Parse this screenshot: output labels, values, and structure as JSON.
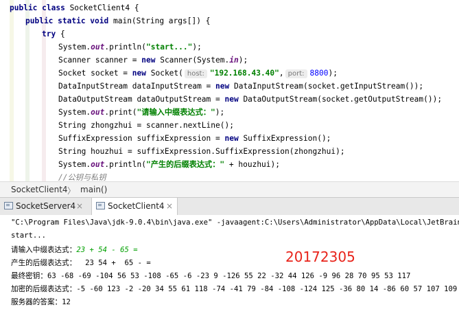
{
  "editor": {
    "line1": {
      "kw": "public class",
      "name": " SocketClient4 {"
    },
    "line2": {
      "kw": "public static void",
      "rest": " main(String args[]) {"
    },
    "line3": {
      "kw": "try",
      "rest": " {"
    },
    "line4": {
      "a": "System.",
      "field": "out",
      "b": ".println(",
      "str": "\"start...\"",
      "c": ");"
    },
    "line5": {
      "a": "Scanner scanner = ",
      "kw": "new",
      "b": " Scanner(System.",
      "field": "in",
      "c": ");"
    },
    "line6": {
      "a": "Socket socket = ",
      "kw": "new",
      "b": " Socket(",
      "hint1": "host:",
      "str": "\"192.168.43.40\"",
      "c": ",",
      "hint2": "port:",
      "num": "8800",
      "d": ");"
    },
    "line7": {
      "a": "DataInputStream dataInputStream = ",
      "kw": "new",
      "b": " DataInputStream(socket.getInputStream());"
    },
    "line8": {
      "a": "DataOutputStream dataOutputStream = ",
      "kw": "new",
      "b": " DataOutputStream(socket.getOutputStream());"
    },
    "line9": {
      "a": "System.",
      "field": "out",
      "b": ".print(",
      "str": "\"请输入中缀表达式：\"",
      "c": ");"
    },
    "line10": {
      "a": "String zhongzhui = scanner.nextLine();"
    },
    "line11": {
      "a": "SuffixExpression suffixExpression = ",
      "kw": "new",
      "b": " SuffixExpression();"
    },
    "line12": {
      "a": "String houzhui = suffixExpression.SuffixExpression(zhongzhui);"
    },
    "line13": {
      "a": "System.",
      "field": "out",
      "b": ".println(",
      "str": "\"产生的后缀表达式：\"",
      "c": " + houzhui);"
    },
    "line14": {
      "comment": "//公钥与私钥"
    }
  },
  "breadcrumb": {
    "class": "SocketClient4",
    "sep": "〉",
    "method": "main()"
  },
  "tabs": [
    {
      "label": "SocketServer4",
      "close": "×"
    },
    {
      "label": "SocketClient4",
      "close": "×"
    }
  ],
  "console": {
    "cmd": "\"C:\\Program Files\\Java\\jdk-9.0.4\\bin\\java.exe\" -javaagent:C:\\Users\\Administrator\\AppData\\Local\\JetBrains\\Tool",
    "start": "start...",
    "infix_label": "请输入中缀表达式：",
    "infix_input": "23 + 54 - 65 =",
    "postfix": "产生的后缀表达式：  23 54 +  65 - =",
    "key": "最终密钥：63 -68 -69 -104 56 53 -108 -65 -6 -23 9 -126 55 22 -32 44 126 -9 96 28 70 95 53 117",
    "encrypted": "加密的后缀表达式：-5 -60 123 -2 -20 34 55 61 118 -74 -41 79 -84 -108 -124 125 -36 80 14 -86 60 57 107 109",
    "answer": "服务器的答案：12"
  },
  "watermark": "20172305"
}
